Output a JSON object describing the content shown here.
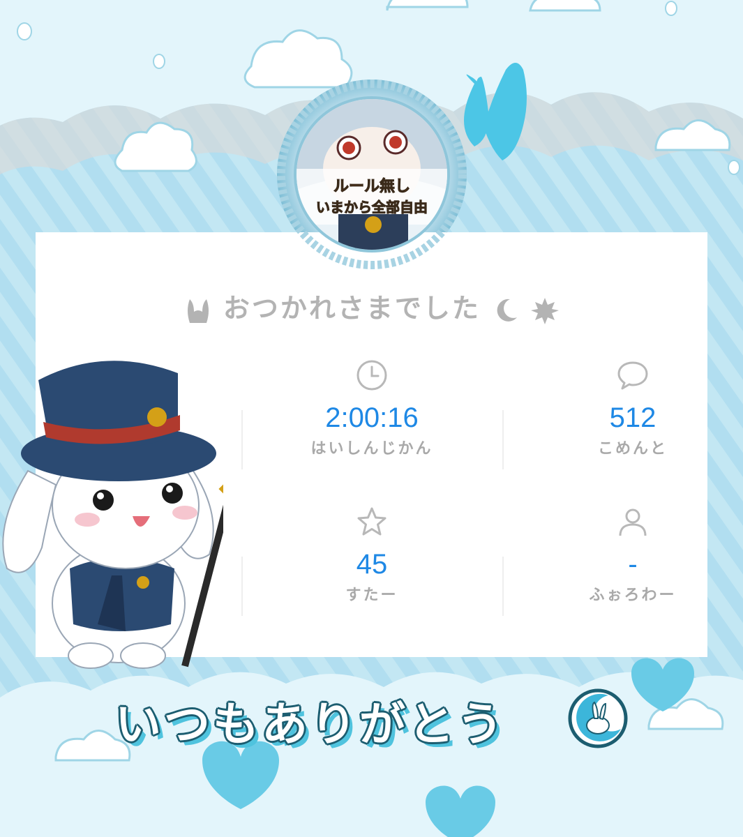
{
  "overlay": {
    "title": "おつかれさまでした",
    "thanks": "いつもありがとう"
  },
  "stats": [
    {
      "icon": "clock-icon",
      "value": "2:00:16",
      "label": "はいしんじかん"
    },
    {
      "icon": "comment-icon",
      "value": "512",
      "label": "こめんと"
    },
    {
      "icon": "star-icon",
      "value": "45",
      "label": "すたー"
    },
    {
      "icon": "person-icon",
      "value": "-",
      "label": "ふぉろわー"
    }
  ],
  "avatar": {
    "text_line1": "ルール無し",
    "text_line2": "いまから全部自由"
  },
  "colors": {
    "background": "#bfe6f2",
    "accent": "#1e88e5",
    "label": "#a9a9a9",
    "outline": "#1c5d70",
    "cloud": "#ffffff"
  }
}
